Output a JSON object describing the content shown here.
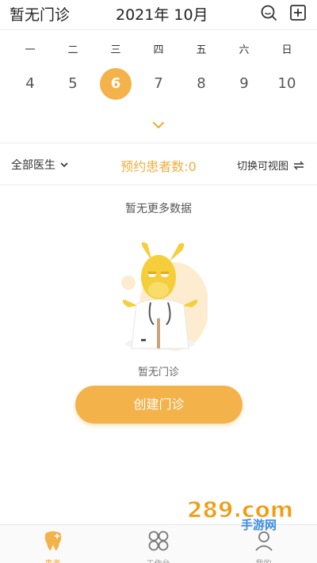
{
  "header": {
    "title": "暂无门诊",
    "month": "2021年 10月",
    "search_icon": "search-icon",
    "add_icon": "add-square-icon"
  },
  "calendar": {
    "weekdays": [
      "一",
      "二",
      "三",
      "四",
      "五",
      "六",
      "日"
    ],
    "dates": [
      "4",
      "5",
      "6",
      "7",
      "8",
      "9",
      "10"
    ],
    "selected_index": 2,
    "accent_color": "#f3b24a",
    "expand_icon": "chevron-down-icon"
  },
  "filter": {
    "doctor_filter": "全部医生",
    "appointment_count": "预约患者数:0",
    "switch_view": "切换可视图"
  },
  "empty": {
    "message": "暂无更多数据",
    "caption": "暂无门诊",
    "button": "创建门诊"
  },
  "tabbar": {
    "items": [
      {
        "label": "患者",
        "icon": "tooth-plus-icon",
        "active": true
      },
      {
        "label": "工作台",
        "icon": "grid-icon",
        "active": false
      },
      {
        "label": "我的",
        "icon": "person-icon",
        "active": false
      }
    ]
  },
  "watermark": {
    "text": "289.com",
    "sub": "手游网"
  }
}
